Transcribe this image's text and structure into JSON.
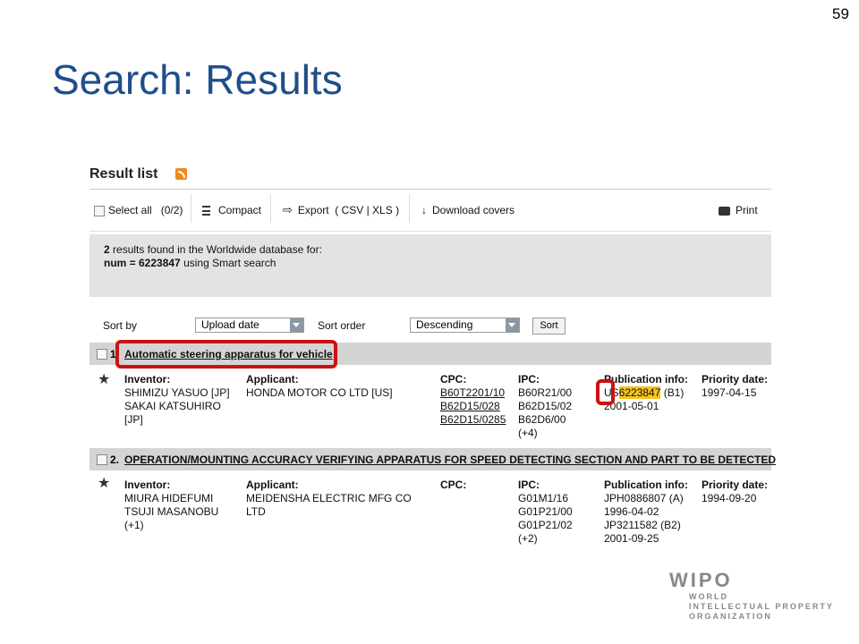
{
  "slide": {
    "number": "59",
    "title": "Search: Results"
  },
  "result_list": {
    "title": "Result list",
    "rss_icon": "rss-icon"
  },
  "toolbar": {
    "select_all": "Select all",
    "select_count": "(0/2)",
    "compact": "Compact",
    "export": "Export",
    "export_formats": "( CSV | XLS )",
    "download_covers": "Download covers",
    "print": "Print"
  },
  "info": {
    "count": "2",
    "line1_rest": " results found in the Worldwide database for:",
    "query": "num = 6223847",
    "line2_rest": " using Smart search"
  },
  "sort": {
    "sort_by_label": "Sort by",
    "sort_by_value": "Upload date",
    "sort_order_label": "Sort order",
    "sort_order_value": "Descending",
    "sort_button": "Sort"
  },
  "results": [
    {
      "number": "1",
      "title": "Automatic steering apparatus for vehicle",
      "inventor_label": "Inventor:",
      "inventors": [
        "SHIMIZU YASUO [JP]",
        "SAKAI KATSUHIRO",
        "[JP]"
      ],
      "applicant_label": "Applicant:",
      "applicants": [
        "HONDA MOTOR CO LTD [US]"
      ],
      "cpc_label": "CPC:",
      "cpc": [
        "B60T2201/10",
        "B62D15/028",
        "B62D15/0285"
      ],
      "ipc_label": "IPC:",
      "ipc": [
        "B60R21/00",
        "B62D15/02",
        "B62D6/00",
        "(+4)"
      ],
      "pub_label": "Publication info:",
      "pub_prefix": "US",
      "pub_number": "6223847",
      "pub_kind": " (B1)",
      "pub_date": "2001-05-01",
      "priority_label": "Priority date:",
      "priority": "1997-04-15"
    },
    {
      "number": "2.",
      "title": "OPERATION/MOUNTING ACCURACY VERIFYING APPARATUS FOR SPEED DETECTING SECTION AND PART TO BE DETECTED",
      "inventor_label": "Inventor:",
      "inventors": [
        "MIURA HIDEFUMI",
        "TSUJI MASANOBU",
        "(+1)"
      ],
      "applicant_label": "Applicant:",
      "applicants": [
        "MEIDENSHA ELECTRIC MFG CO",
        "LTD"
      ],
      "cpc_label": "CPC:",
      "ipc_label": "IPC:",
      "ipc": [
        "G01M1/16",
        "G01P21/00",
        "G01P21/02",
        "(+2)"
      ],
      "pub_label": "Publication info:",
      "pub": [
        "JPH0886807 (A)",
        "1996-04-02",
        "JP3211582 (B2)",
        "2001-09-25"
      ],
      "priority_label": "Priority date:",
      "priority": "1994-09-20"
    }
  ],
  "logo": {
    "name": "WIPO",
    "sub": [
      "WORLD",
      "INTELLECTUAL PROPERTY",
      "ORGANIZATION"
    ],
    "color": "#888888"
  },
  "colors": {
    "title": "#1f4e8c",
    "highlight_box": "#cc1111",
    "match_highlight": "#f5c321"
  }
}
